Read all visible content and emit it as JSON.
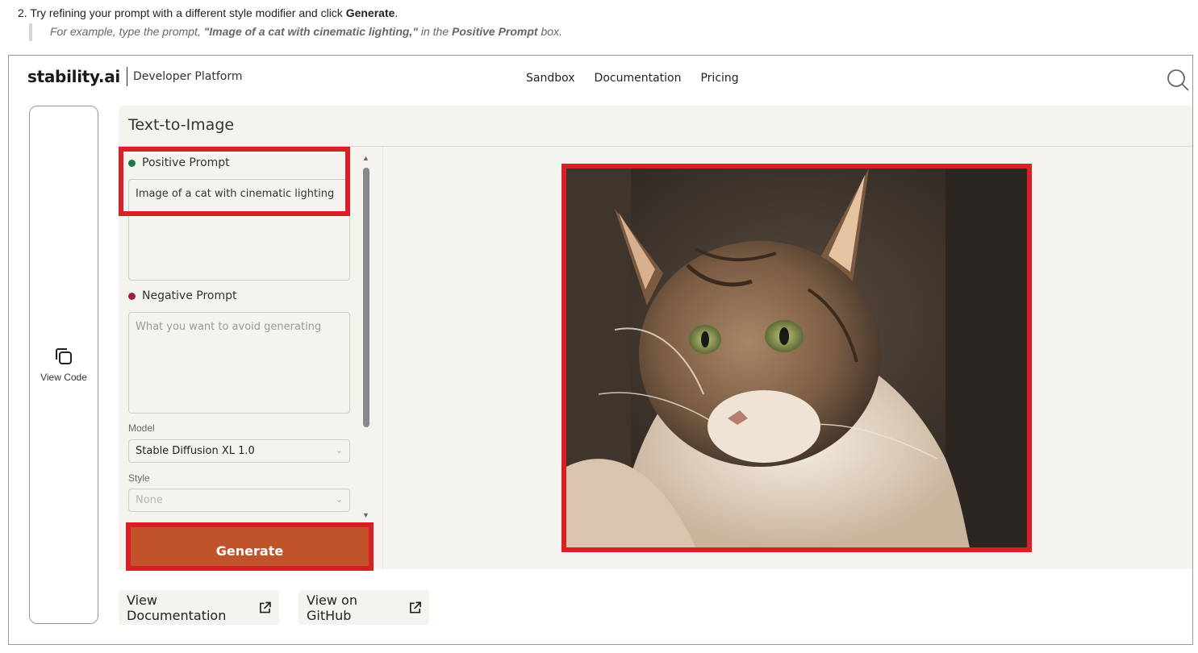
{
  "doc": {
    "step_text": "2. Try refining your prompt with a different style modifier and click ",
    "step_bold": "Generate",
    "step_end": ".",
    "quote_lead": "For example, type the prompt, ",
    "quote_prompt": "\"Image of a cat with cinematic lighting,\"",
    "quote_mid": " in the ",
    "quote_box": "Positive Prompt",
    "quote_end": " box."
  },
  "header": {
    "logo": "stability.ai",
    "subtitle": "Developer Platform",
    "nav": [
      "Sandbox",
      "Documentation",
      "Pricing"
    ]
  },
  "sidebar": {
    "view_code_label": "View Code"
  },
  "panel": {
    "title": "Text-to-Image",
    "positive_label": "Positive Prompt",
    "positive_value": "Image of a cat with cinematic lighting",
    "negative_label": "Negative Prompt",
    "negative_placeholder": "What you want to avoid generating",
    "model_label": "Model",
    "model_value": "Stable Diffusion XL 1.0",
    "style_label": "Style",
    "style_value": "None",
    "generate_label": "Generate"
  },
  "links": {
    "docs": "View Documentation",
    "github": "View on GitHub"
  },
  "colors": {
    "highlight": "#d81f26",
    "generate": "#c1532b",
    "positive_dot": "#1e7a4a",
    "negative_dot": "#9a2340"
  }
}
